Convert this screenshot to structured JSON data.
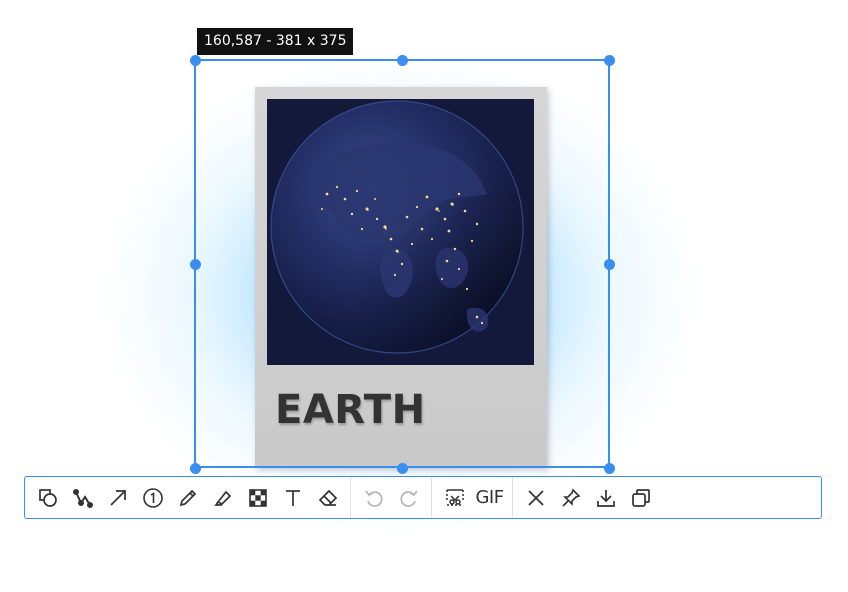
{
  "selection": {
    "info": "160,587 - 381 x 375"
  },
  "card": {
    "title": "EARTH"
  },
  "toolbar": {
    "tools": [
      {
        "name": "shape-tool",
        "icon": "shapes-icon"
      },
      {
        "name": "curve-tool",
        "icon": "bezier-icon"
      },
      {
        "name": "arrow-tool",
        "icon": "arrow-icon"
      },
      {
        "name": "number-marker-tool",
        "icon": "circled-number-icon"
      },
      {
        "name": "pen-tool",
        "icon": "pencil-icon"
      },
      {
        "name": "highlighter-tool",
        "icon": "highlighter-icon"
      },
      {
        "name": "mosaic-tool",
        "icon": "mosaic-icon"
      },
      {
        "name": "text-tool",
        "icon": "text-icon"
      },
      {
        "name": "eraser-tool",
        "icon": "eraser-icon"
      }
    ],
    "history": [
      {
        "name": "undo-button",
        "icon": "undo-icon",
        "enabled": false
      },
      {
        "name": "redo-button",
        "icon": "redo-icon",
        "enabled": false
      }
    ],
    "capture": [
      {
        "name": "scroll-capture-button",
        "icon": "scroll-capture-icon"
      },
      {
        "name": "gif-button",
        "label": "GIF"
      }
    ],
    "actions": [
      {
        "name": "close-button",
        "icon": "close-icon"
      },
      {
        "name": "pin-button",
        "icon": "pin-icon"
      },
      {
        "name": "save-button",
        "icon": "download-icon"
      },
      {
        "name": "copy-button",
        "icon": "copy-icon"
      }
    ]
  },
  "colors": {
    "accent": "#3b8df0",
    "toolbar_border": "#3b8df0",
    "label_bg": "#111111"
  }
}
